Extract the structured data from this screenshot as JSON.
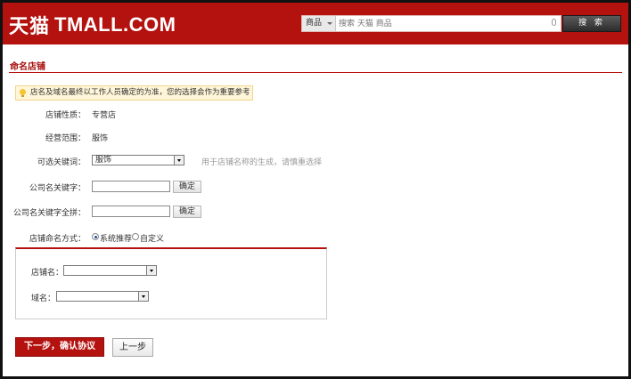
{
  "header": {
    "logo_cn": "天猫",
    "logo_en": "TMALL.COM",
    "search_category": "商品",
    "search_placeholder": "搜索 天猫 商品",
    "search_button": "搜 索"
  },
  "page": {
    "title": "命名店铺",
    "notice": "店名及域名最终以工作人员确定的为准，您的选择会作为重要参考"
  },
  "form": {
    "store_type_label": "店铺性质：",
    "store_type_value": "专营店",
    "scope_label": "经营范围：",
    "scope_value": "服饰",
    "keyword_label": "可选关键词：",
    "keyword_value": "服饰",
    "keyword_hint": "用于店铺名称的生成，请慎重选择",
    "company_kw_label": "公司名关键字：",
    "company_kw_pinyin_label": "公司名关键字全拼：",
    "confirm_label": "确定",
    "naming_label": "店铺命名方式：",
    "naming_options": [
      "系统推荐",
      "自定义"
    ],
    "store_name_label": "店铺名：",
    "domain_label": "域名："
  },
  "actions": {
    "next": "下一步，确认协议",
    "prev": "上一步"
  },
  "colors": {
    "brand_red": "#b4120f",
    "notice_bg": "#fff6d9"
  }
}
